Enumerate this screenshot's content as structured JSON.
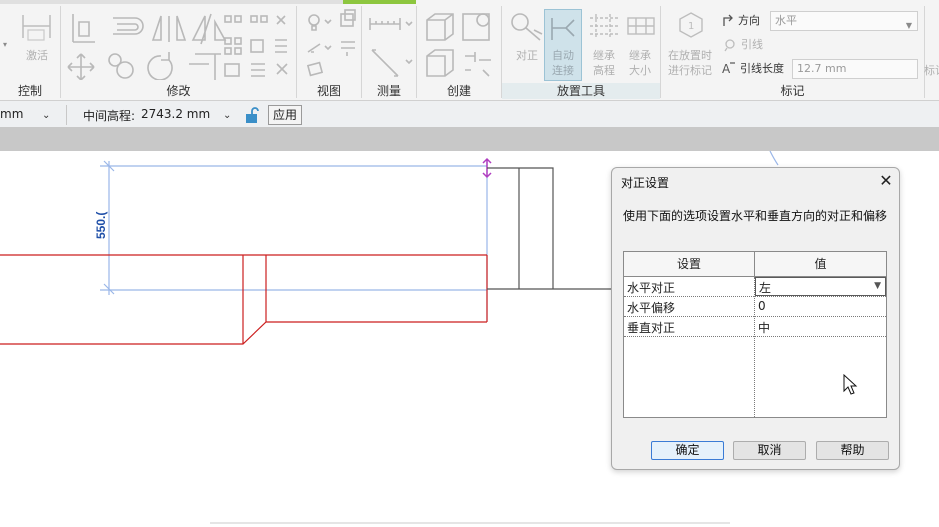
{
  "ribbon": {
    "panels": {
      "control": "控制",
      "modify": "修改",
      "view": "视图",
      "measure": "测量",
      "create": "创建",
      "placement_tools": "放置工具",
      "tag": "标记"
    },
    "tools": {
      "activate": "激活",
      "justify": "对正",
      "auto_connect_1": "自动",
      "auto_connect_2": "连接",
      "inherit_elev_1": "继承",
      "inherit_elev_2": "高程",
      "inherit_size_1": "继承",
      "inherit_size_2": "大小",
      "tag_on_place_1": "在放置时",
      "tag_on_place_2": "进行标记",
      "direction_label": "方向",
      "direction_value": "水平",
      "leader": "引线",
      "leader_length_label": "引线长度",
      "leader_length_value": "12.7 mm",
      "edge_label": "标记"
    }
  },
  "options_bar": {
    "unit_value": "mm",
    "middle_elevation_label": "中间高程:",
    "middle_elevation_value": "2743.2 mm",
    "apply": "应用"
  },
  "canvas": {
    "dimension_text": "550.("
  },
  "dialog": {
    "title": "对正设置",
    "description": "使用下面的选项设置水平和垂直方向的对正和偏移",
    "columns": [
      "设置",
      "值"
    ],
    "rows": [
      {
        "setting": "水平对正",
        "value": "左"
      },
      {
        "setting": "水平偏移",
        "value": "0"
      },
      {
        "setting": "垂直对正",
        "value": "中"
      }
    ],
    "buttons": {
      "ok": "确定",
      "cancel": "取消",
      "help": "帮助"
    }
  },
  "colors": {
    "ribbon_accent": "#8dc63f",
    "duct_red": "#cc1f1f",
    "dimension_blue": "#9ab6e8",
    "dimension_text": "#1f4fa8",
    "handle_purple": "#b03ec0",
    "lock_icon": "#3a8fc8"
  }
}
